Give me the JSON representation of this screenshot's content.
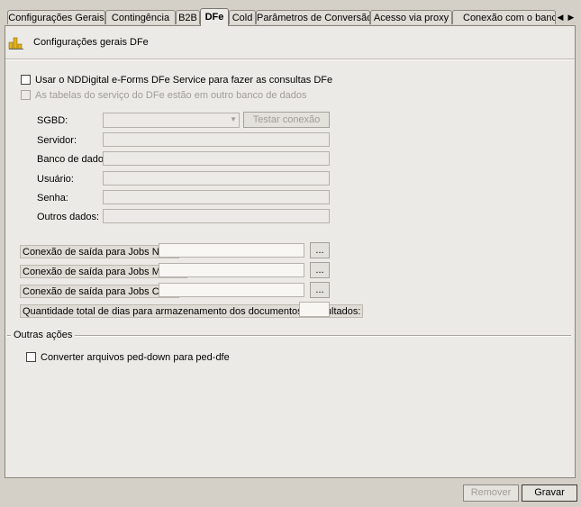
{
  "tabs": [
    {
      "label": "Configurações Gerais"
    },
    {
      "label": "Contingência"
    },
    {
      "label": "B2B"
    },
    {
      "label": "DFe"
    },
    {
      "label": "Cold"
    },
    {
      "label": "Parâmetros de Conversão"
    },
    {
      "label": "Acesso via proxy"
    },
    {
      "label": "Conexão com o banco de"
    }
  ],
  "tab_scroll": {
    "left": "◀",
    "right": "▶"
  },
  "header": {
    "title": "Configurações gerais DFe",
    "icon": "chart-bars-icon"
  },
  "options": {
    "use_service_label": "Usar o NDDigital e-Forms DFe Service para fazer as consultas DFe",
    "other_db_label": "As tabelas do serviço do DFe estão em outro banco de dados"
  },
  "db": {
    "sgbd_label": "SGBD:",
    "sgbd_value": "",
    "test_button": "Testar conexão",
    "server_label": "Servidor:",
    "database_label": "Banco de dados:",
    "user_label": "Usuário:",
    "password_label": "Senha:",
    "other_label": "Outros dados:"
  },
  "jobs": {
    "nfe_label": "Conexão de saída para Jobs NF-e:",
    "mdfe_label": "Conexão de saída para Jobs MDF-e:",
    "cte_label": "Conexão de saída para Jobs CT-e:",
    "browse_button": "...",
    "days_label": "Quantidade total de dias para armazenamento dos documentos consultados:"
  },
  "other_actions": {
    "title": "Outras ações",
    "convert_label": "Converter arquivos ped-down para ped-dfe"
  },
  "footer": {
    "remove_button": "Remover",
    "save_button": "Gravar"
  }
}
